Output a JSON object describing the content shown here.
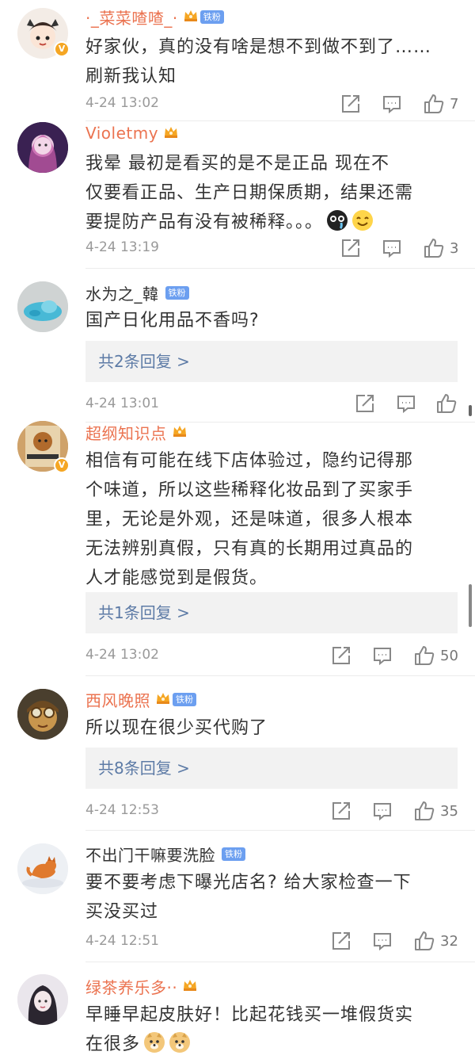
{
  "comments": [
    {
      "username": "·_菜菜喳喳_·",
      "verified": true,
      "badge": "铁粉",
      "text_lines": [
        "好家伙，真的没有啥是想不到做不到了……",
        "刷新我认知"
      ],
      "time": "4-24 13:02",
      "likes": "7"
    },
    {
      "username": "Violetmy",
      "verified": false,
      "text_lines": [
        "我晕 最初是看买的是不是正品 现在不",
        "仅要看正品、生产日期保质期，结果还需",
        "要提防产品有没有被稀释。。。"
      ],
      "time": "4-24 13:19",
      "likes": "3"
    },
    {
      "username": "水为之_韓",
      "verified": false,
      "badge": "铁粉",
      "text_lines": [
        "国产日化用品不香吗?"
      ],
      "replies": "共2条回复 >",
      "time": "4-24 13:01",
      "likes": ""
    },
    {
      "username": "超纲知识点",
      "verified": true,
      "text_lines": [
        "相信有可能在线下店体验过，隐约记得那",
        "个味道，所以这些稀释化妆品到了买家手",
        "里，无论是外观，还是味道，很多人根本",
        "无法辨别真假，只有真的长期用过真品的",
        "人才能感觉到是假货。"
      ],
      "replies": "共1条回复 >",
      "time": "4-24 13:02",
      "likes": "50"
    },
    {
      "username": "西风晚照",
      "verified": false,
      "badge": "铁粉",
      "text_lines": [
        "所以现在很少买代购了"
      ],
      "replies": "共8条回复 >",
      "time": "4-24 12:53",
      "likes": "35"
    },
    {
      "username": "不出门干嘛要洗脸",
      "verified": false,
      "badge": "铁粉",
      "text_lines": [
        "要不要考虑下曝光店名? 给大家检查一下",
        "买没买过"
      ],
      "time": "4-24 12:51",
      "likes": "32"
    },
    {
      "username": "绿茶养乐多··",
      "verified": false,
      "text_lines": [
        "早睡早起皮肤好！比起花钱买一堆假货实",
        "在很多"
      ],
      "time": "",
      "likes": ""
    }
  ],
  "colors": {
    "username_accent": "#eb7350",
    "reply_link": "#5d7ba6",
    "badge_blue": "#6c9ff0",
    "muted": "#999999"
  },
  "icons": [
    "share-icon",
    "comment-icon",
    "like-icon",
    "crown-icon",
    "verified-v-icon"
  ]
}
